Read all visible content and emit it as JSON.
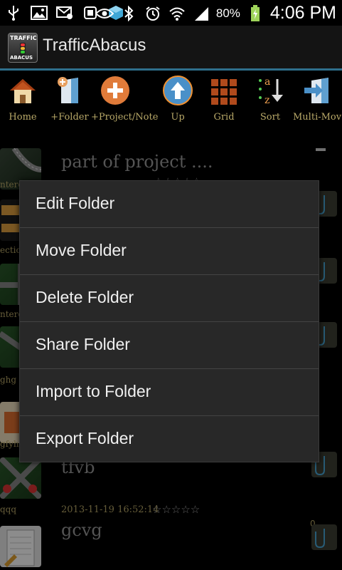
{
  "status_bar": {
    "battery_percent": "80%",
    "time": "4:06 PM",
    "icons": [
      "usb-icon",
      "image-icon",
      "gmail-icon",
      "square-icon",
      "cube-app-icon",
      "eye-icon",
      "bluetooth-icon",
      "alarm-icon",
      "wifi-icon",
      "signal-icon",
      "battery-charging-icon"
    ]
  },
  "action_bar": {
    "logo_text_top": "TRAFFIC",
    "logo_text_bottom": "ABACUS",
    "title": "TrafficAbacus"
  },
  "toolbar": {
    "items": [
      {
        "label": "Home",
        "icon": "house-icon"
      },
      {
        "label": "+Folder",
        "icon": "add-folder-icon"
      },
      {
        "label": "+Project/Note",
        "icon": "add-circle-icon"
      },
      {
        "label": "Up",
        "icon": "up-arrow-icon"
      },
      {
        "label": "Grid",
        "icon": "grid-icon"
      },
      {
        "label": "Sort",
        "icon": "sort-az-icon"
      },
      {
        "label": "Multi-Mov",
        "icon": "multi-move-icon"
      }
    ]
  },
  "list": {
    "rows": [
      {
        "title": "part of project ....",
        "thumb_label": "nterc",
        "date": ""
      },
      {
        "title": "",
        "thumb_label": "ectio",
        "date": ""
      },
      {
        "title": "",
        "thumb_label": "nterc",
        "date": ""
      },
      {
        "title": "",
        "thumb_label": "ghg",
        "date": ""
      },
      {
        "title": "",
        "thumb_label": "gfyh",
        "date": ""
      },
      {
        "title": "tfvb",
        "thumb_label": "qqq",
        "date": ""
      },
      {
        "title": "gcvg",
        "thumb_label": "",
        "date": "2013-11-19 16:52:14"
      }
    ],
    "count": "0",
    "stars": "☆☆☆☆☆"
  },
  "context_menu": {
    "items": [
      "Edit Folder",
      "Move Folder",
      "Delete Folder",
      "Share Folder",
      "Import to Folder",
      "Export Folder"
    ]
  },
  "colors": {
    "accent_line": "#2e6f8c",
    "label_gold": "#b8a868",
    "menu_bg": "#282828"
  }
}
